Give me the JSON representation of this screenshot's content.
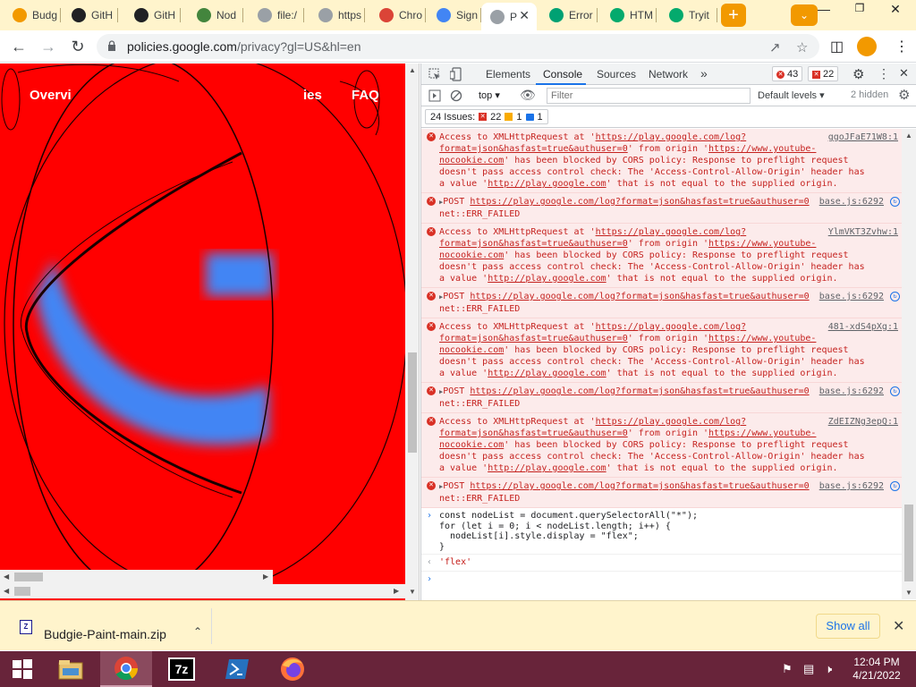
{
  "tabs": [
    {
      "label": "Budg",
      "favicon": "budgie-paint-icon",
      "color": "#f29900"
    },
    {
      "label": "GitH",
      "favicon": "github-icon",
      "color": "#202124"
    },
    {
      "label": "GitH",
      "favicon": "github-icon",
      "color": "#202124"
    },
    {
      "label": "Nod",
      "favicon": "nodejs-icon",
      "color": "#43853d"
    },
    {
      "label": "file:/",
      "favicon": "globe-icon",
      "color": "#9aa0a6"
    },
    {
      "label": "https",
      "favicon": "globe-icon",
      "color": "#9aa0a6"
    },
    {
      "label": "Chro",
      "favicon": "chrome-icon",
      "color": "#db4437"
    },
    {
      "label": "Sign",
      "favicon": "google-icon",
      "color": "#4285f4"
    },
    {
      "label": "P",
      "favicon": "globe-icon",
      "color": "#9aa0a6",
      "active": true
    },
    {
      "label": "Error",
      "favicon": "play-icon",
      "color": "#00a173"
    },
    {
      "label": "HTM",
      "favicon": "w3schools-icon",
      "color": "#04aa6d"
    },
    {
      "label": "Tryit",
      "favicon": "w3schools-icon",
      "color": "#04aa6d"
    }
  ],
  "toolbar": {
    "url_host": "policies.google.com",
    "url_rest": "/privacy?gl=US&hl=en"
  },
  "page": {
    "nav_overview": "Overvi",
    "nav_policies": "ies",
    "nav_faq": "FAQ",
    "background": "#ff0000",
    "accent": "#4285f4"
  },
  "devtools": {
    "tabs": [
      "Elements",
      "Console",
      "Sources",
      "Network"
    ],
    "active_tab": "Console",
    "error_count": "43",
    "warning_count": "22",
    "context": "top",
    "filter_placeholder": "Filter",
    "levels": "Default levels",
    "hidden": "2 hidden",
    "issues_label": "24 Issues:",
    "issues_errors": "22",
    "issues_warnings": "1",
    "issues_info": "1"
  },
  "console": {
    "messages": [
      {
        "type": "cors",
        "text1": "Access to XMLHttpRequest at '",
        "url1": "https://play.google.com/log?format=json&hasfast=true&authuser=0",
        "text2": "' from origin '",
        "url2": "https://www.youtube-nocookie.com",
        "text3": "' has been blocked by CORS policy: Response to preflight request doesn't pass access control check: The 'Access-Control-Allow-Origin' header has a value '",
        "url3": "http://play.google.com",
        "text4": "' that is not equal to the supplied origin.",
        "src": "ggoJFaE71W8:1"
      },
      {
        "type": "post",
        "method": "POST",
        "url": "https://play.google.com/log?format=json&hasfast=true&authuser=0",
        "error": "net::ERR_FAILED",
        "src": "base.js:6292"
      },
      {
        "type": "cors",
        "text1": "Access to XMLHttpRequest at '",
        "url1": "https://play.google.com/log?format=json&hasfast=true&authuser=0",
        "text2": "' from origin '",
        "url2": "https://www.youtube-nocookie.com",
        "text3": "' has been blocked by CORS policy: Response to preflight request doesn't pass access control check: The 'Access-Control-Allow-Origin' header has a value '",
        "url3": "http://play.google.com",
        "text4": "' that is not equal to the supplied origin.",
        "src": "YlmVKT3Zvhw:1"
      },
      {
        "type": "post",
        "method": "POST",
        "url": "https://play.google.com/log?format=json&hasfast=true&authuser=0",
        "error": "net::ERR_FAILED",
        "src": "base.js:6292"
      },
      {
        "type": "cors",
        "text1": "Access to XMLHttpRequest at '",
        "url1": "https://play.google.com/log?format=json&hasfast=true&authuser=0",
        "text2": "' from origin '",
        "url2": "https://www.youtube-nocookie.com",
        "text3": "' has been blocked by CORS policy: Response to preflight request doesn't pass access control check: The 'Access-Control-Allow-Origin' header has a value '",
        "url3": "http://play.google.com",
        "text4": "' that is not equal to the supplied origin.",
        "src": "481-xdS4pXg:1"
      },
      {
        "type": "post",
        "method": "POST",
        "url": "https://play.google.com/log?format=json&hasfast=true&authuser=0",
        "error": "net::ERR_FAILED",
        "src": "base.js:6292"
      },
      {
        "type": "cors",
        "text1": "Access to XMLHttpRequest at '",
        "url1": "https://play.google.com/log?format=json&hasfast=true&authuser=0",
        "text2": "' from origin '",
        "url2": "https://www.youtube-nocookie.com",
        "text3": "' has been blocked by CORS policy: Response to preflight request doesn't pass access control check: The 'Access-Control-Allow-Origin' header has a value '",
        "url3": "http://play.google.com",
        "text4": "' that is not equal to the supplied origin.",
        "src": "ZdEIZNg3epQ:1"
      },
      {
        "type": "post",
        "method": "POST",
        "url": "https://play.google.com/log?format=json&hasfast=true&authuser=0",
        "error": "net::ERR_FAILED",
        "src": "base.js:6292"
      }
    ],
    "code": "const nodeList = document.querySelectorAll(\"*\");\nfor (let i = 0; i < nodeList.length; i++) {\n  nodeList[i].style.display = \"flex\";\n}",
    "result": "'flex'"
  },
  "download": {
    "filename": "Budgie-Paint-main.zip",
    "show_all": "Show all"
  },
  "taskbar": {
    "time": "12:04 PM",
    "date": "4/21/2022"
  }
}
